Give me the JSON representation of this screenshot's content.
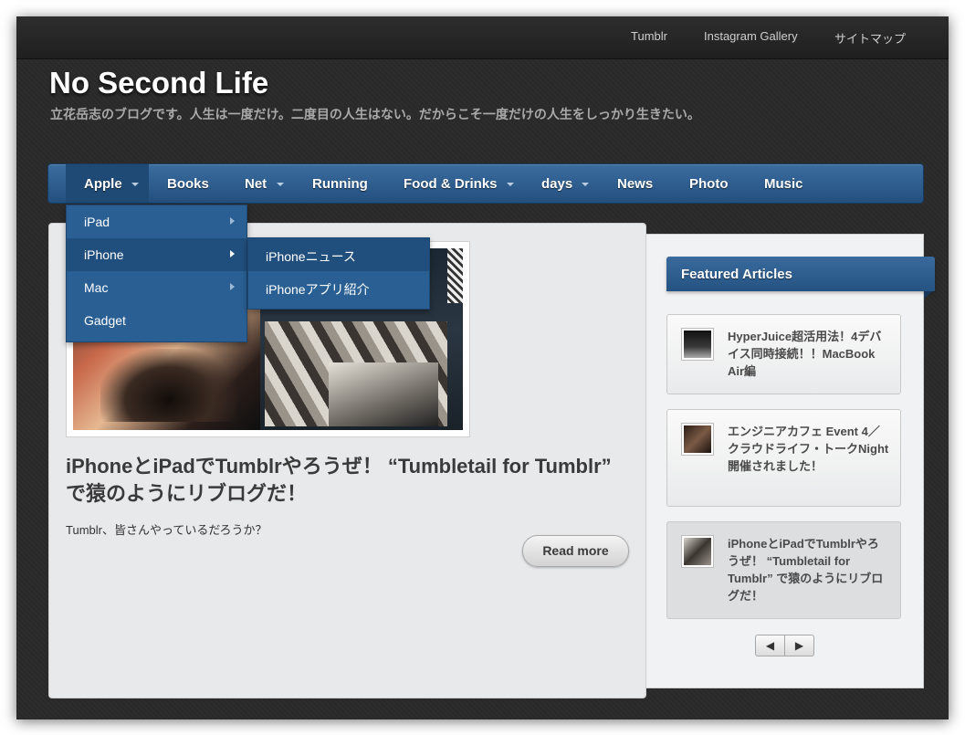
{
  "topbar": {
    "links": [
      "Tumblr",
      "Instagram Gallery",
      "サイトマップ"
    ]
  },
  "header": {
    "title": "No Second Life",
    "description": "立花岳志のブログです。人生は一度だけ。二度目の人生はない。だからこそ一度だけの人生をしっかり生きたい。"
  },
  "nav": {
    "items": [
      {
        "label": "Apple",
        "has_submenu": true
      },
      {
        "label": "Books",
        "has_submenu": false
      },
      {
        "label": "Net",
        "has_submenu": true
      },
      {
        "label": "Running",
        "has_submenu": false
      },
      {
        "label": "Food & Drinks",
        "has_submenu": true
      },
      {
        "label": "days",
        "has_submenu": true
      },
      {
        "label": "News",
        "has_submenu": false
      },
      {
        "label": "Photo",
        "has_submenu": false
      },
      {
        "label": "Music",
        "has_submenu": false
      }
    ],
    "dropdown": [
      "iPad",
      "iPhone",
      "Mac",
      "Gadget"
    ],
    "submenu": [
      "iPhoneニュース",
      "iPhoneアプリ紹介"
    ]
  },
  "post": {
    "title": "iPhoneとiPadでTumblrやろうぜ！ “Tumbletail for Tumblr” で猿のようにリブログだ！",
    "excerpt": "Tumblr、皆さんやっているだろうか？",
    "read_more": "Read more"
  },
  "featured": {
    "heading": "Featured Articles",
    "articles": [
      "HyperJuice超活用法！4デバイス同時接続！！MacBook Air編",
      "エンジニアカフェ Event 4／クラウドライフ・トークNight 開催されました！",
      "iPhoneとiPadでTumblrやろうぜ！ “Tumbletail for Tumblr” で猿のようにリブログだ！"
    ],
    "active_index": 2,
    "pager": {
      "prev": "◀",
      "next": "▶"
    }
  },
  "colors": {
    "nav_blue": "#2c5f93",
    "background": "#2a2a2a",
    "content_bg": "#e8e9eb"
  }
}
